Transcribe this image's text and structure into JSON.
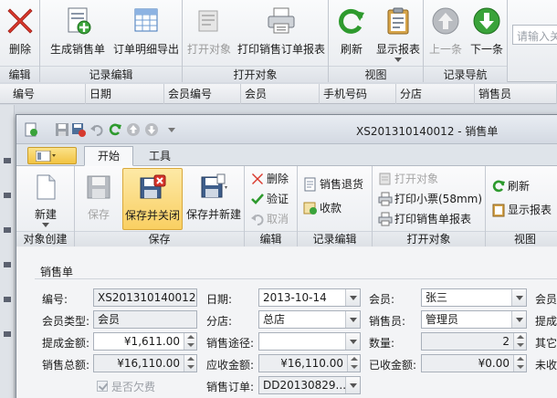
{
  "outer_ribbon": {
    "groups": [
      {
        "label": "编辑",
        "buttons": [
          {
            "label": "删除",
            "icon": "delete-x-icon",
            "enabled": true
          }
        ]
      },
      {
        "label": "记录编辑",
        "buttons": [
          {
            "label": "生成销售单",
            "icon": "new-sales-doc-icon",
            "enabled": true
          },
          {
            "label": "订单明细导出",
            "icon": "export-table-icon",
            "enabled": true
          }
        ]
      },
      {
        "label": "打开对象",
        "buttons": [
          {
            "label": "打开对象",
            "icon": "open-object-icon",
            "enabled": false
          },
          {
            "label": "打印销售订单报表",
            "icon": "printer-icon",
            "enabled": true
          }
        ]
      },
      {
        "label": "视图",
        "buttons": [
          {
            "label": "刷新",
            "icon": "refresh-icon",
            "enabled": true
          },
          {
            "label": "显示报表",
            "icon": "clipboard-report-icon",
            "enabled": true
          }
        ]
      },
      {
        "label": "记录导航",
        "buttons": [
          {
            "label": "上一条",
            "icon": "arrow-up-icon",
            "enabled": false
          },
          {
            "label": "下一条",
            "icon": "arrow-down-icon",
            "enabled": true
          }
        ]
      }
    ],
    "search_placeholder": "请输入关"
  },
  "grid_columns": [
    "编号",
    "日期",
    "会员编号",
    "会员",
    "手机号码",
    "分店",
    "销售员"
  ],
  "window": {
    "title": "XS201310140012 - 销售单",
    "tabs": [
      {
        "label": "开始",
        "active": true
      },
      {
        "label": "工具",
        "active": false
      }
    ],
    "ribbon": {
      "groups": {
        "create": {
          "label": "对象创建",
          "new": "新建"
        },
        "save": {
          "label": "保存",
          "save": "保存",
          "save_close": "保存并关闭",
          "save_new": "保存并新建"
        },
        "edit": {
          "label": "编辑",
          "delete": "删除",
          "verify": "验证",
          "cancel": "取消"
        },
        "record_edit": {
          "label": "记录编辑",
          "return": "销售退货",
          "collect": "收款"
        },
        "open_object": {
          "label": "打开对象",
          "open": "打开对象",
          "print_ticket": "打印小票(58mm)",
          "print_report": "打印销售单报表"
        },
        "view": {
          "label": "视图",
          "refresh": "刷新",
          "show_report": "显示报表"
        }
      }
    }
  },
  "form": {
    "section": "销售单",
    "fields": {
      "number": {
        "label": "编号:",
        "value": "XS201310140012"
      },
      "date": {
        "label": "日期:",
        "value": "2013-10-14"
      },
      "member": {
        "label": "会员:",
        "value": "张三"
      },
      "member_extra": {
        "label": "会员"
      },
      "member_type": {
        "label": "会员类型:",
        "value": "会员"
      },
      "branch": {
        "label": "分店:",
        "value": "总店"
      },
      "salesperson": {
        "label": "销售员:",
        "value": "管理员"
      },
      "commission_extra": {
        "label": "提成"
      },
      "commission": {
        "label": "提成金额:",
        "value": "¥1,611.00"
      },
      "channel": {
        "label": "销售途径:",
        "value": ""
      },
      "quantity": {
        "label": "数量:",
        "value": "2"
      },
      "other_extra": {
        "label": "其它"
      },
      "total": {
        "label": "销售总额:",
        "value": "¥16,110.00"
      },
      "receivable": {
        "label": "应收金额:",
        "value": "¥16,110.00"
      },
      "received": {
        "label": "已收金额:",
        "value": "¥0.00"
      },
      "unreceived_extra": {
        "label": "未收"
      },
      "is_debt": {
        "label": "是否欠费"
      },
      "sales_order": {
        "label": "销售订单:",
        "value": "DD20130829..."
      }
    }
  }
}
